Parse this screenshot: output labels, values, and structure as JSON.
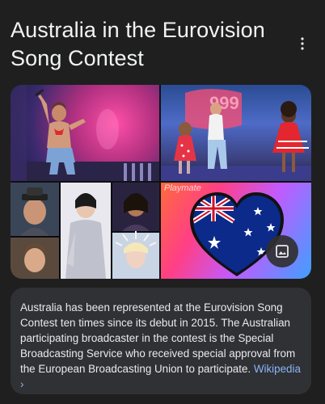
{
  "header": {
    "title": "Australia in the Eurovision Song Contest",
    "more_icon": "more-vertical-icon"
  },
  "gallery": {
    "images": [
      {
        "alt": "Performer on stage with microphone"
      },
      {
        "alt": "Performers in red polka dot outfits on stage"
      },
      {
        "alt": "Collage of Australian Eurovision contestants"
      },
      {
        "alt": "Heart shaped Australian flag on gradient background"
      }
    ],
    "overlay_text": "Playmate",
    "image_button_icon": "image-icon"
  },
  "description": {
    "text": "Australia has been represented at the Eurovision Song Contest ten times since its debut in 2015. The Australian participating broadcaster in the contest is the Special Broadcasting Service who received special approval from the European Broadcasting Union to participate.",
    "link_label": "Wikipedia ›"
  },
  "colors": {
    "background": "#1f1f1f",
    "card": "#303134",
    "link": "#8ab4f8",
    "text": "#e8eaed"
  }
}
